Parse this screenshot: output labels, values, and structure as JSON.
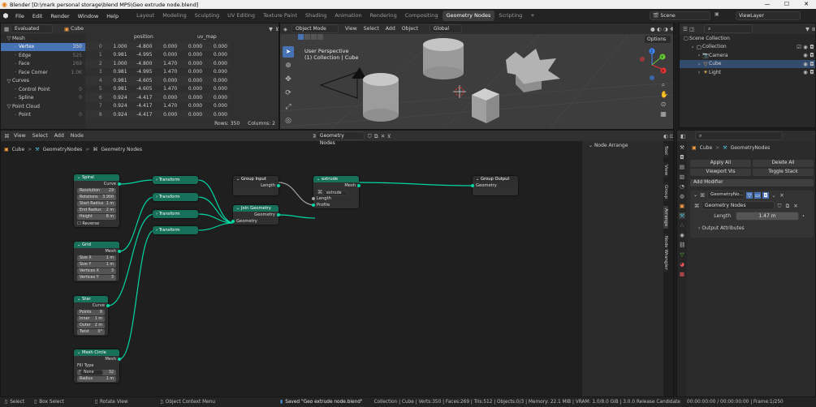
{
  "window": {
    "title": "Blender [D:\\mark personal storage\\blend MPS\\Geo extrude node.blend]",
    "minimize": "—",
    "maximize": "☐",
    "close": "✕"
  },
  "menu": [
    "File",
    "Edit",
    "Render",
    "Window",
    "Help"
  ],
  "workspaces": [
    "Layout",
    "Modeling",
    "Sculpting",
    "UV Editing",
    "Texture Paint",
    "Shading",
    "Animation",
    "Rendering",
    "Compositing",
    "Geometry Nodes",
    "Scripting"
  ],
  "active_workspace": "Geometry Nodes",
  "scene": "Scene",
  "view_layer": "ViewLayer",
  "spreadsheet": {
    "mode": "Evaluated",
    "object": "Cube",
    "groups": [
      {
        "label": "Mesh",
        "items": [
          {
            "label": "Vertex",
            "count": "350",
            "active": true
          },
          {
            "label": "Edge",
            "count": "525"
          },
          {
            "label": "Face",
            "count": "269"
          },
          {
            "label": "Face Corner",
            "count": "1.0K"
          }
        ]
      },
      {
        "label": "Curves",
        "items": [
          {
            "label": "Control Point",
            "count": "0"
          },
          {
            "label": "Spline",
            "count": "0"
          }
        ]
      },
      {
        "label": "Point Cloud",
        "items": [
          {
            "label": "Point",
            "count": "0"
          }
        ]
      }
    ],
    "columns": [
      "position",
      "uv_map"
    ],
    "rows": [
      [
        "0",
        "1.000",
        "-4.800",
        "0.000",
        "0.000",
        "0.000"
      ],
      [
        "1",
        "0.981",
        "-4.995",
        "0.000",
        "0.000",
        "0.000"
      ],
      [
        "2",
        "1.000",
        "-4.800",
        "1.470",
        "0.000",
        "0.000"
      ],
      [
        "3",
        "0.981",
        "-4.995",
        "1.470",
        "0.000",
        "0.000"
      ],
      [
        "4",
        "0.981",
        "-4.605",
        "0.000",
        "0.000",
        "0.000"
      ],
      [
        "5",
        "0.981",
        "-4.605",
        "1.470",
        "0.000",
        "0.000"
      ],
      [
        "6",
        "0.924",
        "-4.417",
        "0.000",
        "0.000",
        "0.000"
      ],
      [
        "7",
        "0.924",
        "-4.417",
        "1.470",
        "0.000",
        "0.000"
      ],
      [
        "8",
        "0.924",
        "-4.417",
        "0.000",
        "0.000",
        "0.000"
      ]
    ],
    "footer_rows": "Rows: 350",
    "footer_cols": "Columns: 2"
  },
  "viewport": {
    "mode": "Object Mode",
    "menus": [
      "View",
      "Select",
      "Add",
      "Object"
    ],
    "orientation": "Global",
    "options": "Options",
    "overlay_title": "User Perspective",
    "overlay_sub": "(1) Collection | Cube",
    "axes": {
      "x": "X",
      "y": "Y",
      "z": "Z"
    }
  },
  "outliner": {
    "title": "Scene Collection",
    "items": [
      {
        "label": "Collection",
        "depth": 1
      },
      {
        "label": "Camera",
        "depth": 2
      },
      {
        "label": "Cube",
        "depth": 2
      },
      {
        "label": "Light",
        "depth": 2
      }
    ]
  },
  "node_editor": {
    "menus": [
      "View",
      "Select",
      "Add",
      "Node"
    ],
    "tree": "Geometry Nodes",
    "breadcrumb": [
      "Cube",
      "GeometryNodes",
      "Geometry Nodes"
    ],
    "node_arrange": "Node Arrange",
    "side_tabs": [
      "Tool",
      "View",
      "Group",
      "Arrange",
      "Node Wrangler"
    ],
    "nodes": {
      "spiral": {
        "title": "Spiral",
        "out": "Curve",
        "fields": [
          [
            "Resolution",
            "29"
          ],
          [
            "Rotations",
            "3.900"
          ],
          [
            "Start Radius",
            "1 m"
          ],
          [
            "End Radius",
            "2 m"
          ],
          [
            "Height",
            "8 m"
          ]
        ],
        "check": "Reverse"
      },
      "grid": {
        "title": "Grid",
        "out": "Mesh",
        "fields": [
          [
            "Size X",
            "1 m"
          ],
          [
            "Size Y",
            "1 m"
          ],
          [
            "Vertices X",
            "3"
          ],
          [
            "Vertices Y",
            "3"
          ]
        ]
      },
      "star": {
        "title": "Star",
        "out": "Curve",
        "fields": [
          [
            "Points",
            "8"
          ],
          [
            "Inner",
            "1 m"
          ],
          [
            "Outer",
            "2 m"
          ],
          [
            "Twist",
            "0°"
          ]
        ]
      },
      "mesh_circle": {
        "title": "Mesh Circle",
        "out": "Mesh",
        "filltype_label": "Fill Type",
        "filltype": "None",
        "fields": [
          [
            "Vertices",
            "32"
          ],
          [
            "Radius",
            "1 m"
          ]
        ]
      },
      "transforms": [
        "Transform",
        "Transform",
        "Transform",
        "Transform"
      ],
      "group_input": {
        "title": "Group Input",
        "out": "Length"
      },
      "join": {
        "title": "Join Geometry",
        "out": "Geometry",
        "in": "Geometry"
      },
      "extrude": {
        "title": "extrude",
        "out": "Mesh",
        "group": "extrude",
        "in": [
          "Length",
          "Profile"
        ]
      },
      "group_output": {
        "title": "Group Output",
        "in": "Geometry"
      }
    }
  },
  "properties": {
    "breadcrumb": [
      "Cube",
      "GeometryNodes"
    ],
    "apply_all": "Apply All",
    "delete_all": "Delete All",
    "viewport_vis": "Viewport Vis",
    "toggle_stack": "Toggle Stack",
    "add_modifier": "Add Modifier",
    "modifier_name": "GeometryNo...",
    "node_group": "Geometry Nodes",
    "length_label": "Length",
    "length_value": "1.47 m",
    "output_attrs": "Output Attributes"
  },
  "status": {
    "select": "Select",
    "box_select": "Box Select",
    "rotate_view": "Rotate View",
    "context_menu": "Object Context Menu",
    "message": "Saved \"Geo extrude node.blend\"",
    "stats": "Collection | Cube | Verts:350 | Faces:269 | Tris:512 | Objects:0/3 | Memory: 22.1 MiB | VRAM: 1.0/8.0 GiB | 3.0.0 Release Candidate",
    "time": "00:00:00:00 / 00:00:00:00 | Frame:1/250"
  },
  "colors": {
    "accent": "#4772b3",
    "node_green": "#17705a",
    "wire": "#00d6a3"
  }
}
